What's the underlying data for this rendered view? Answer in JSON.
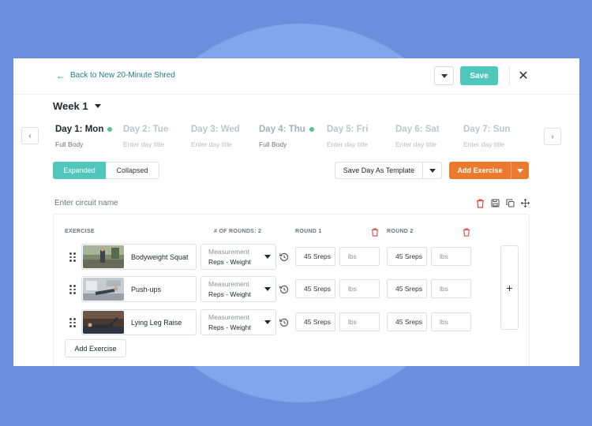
{
  "topbar": {
    "back_label": "Back to New 20-Minute Shred",
    "save_label": "Save"
  },
  "week": {
    "label": "Week 1"
  },
  "days": [
    {
      "label": "Day 1: Mon",
      "title": "Full Body",
      "state": "active",
      "done": true
    },
    {
      "label": "Day 2: Tue",
      "title": "Enter day title",
      "state": "empty",
      "done": false
    },
    {
      "label": "Day 3: Wed",
      "title": "Enter day title",
      "state": "empty",
      "done": false
    },
    {
      "label": "Day 4: Thu",
      "title": "Full Body",
      "state": "complete",
      "done": true
    },
    {
      "label": "Day 5: Fri",
      "title": "Enter day title",
      "state": "empty",
      "done": false
    },
    {
      "label": "Day 6: Sat",
      "title": "Enter day title",
      "state": "empty",
      "done": false
    },
    {
      "label": "Day 7: Sun",
      "title": "Enter day title",
      "state": "empty",
      "done": false
    }
  ],
  "view_toggle": {
    "expanded": "Expanded",
    "collapsed": "Collapsed",
    "selected": "Expanded"
  },
  "save_template_label": "Save Day As Template",
  "add_exercise_label": "Add Exercise",
  "circuit": {
    "name_placeholder": "Enter circuit name",
    "headers": {
      "exercise": "EXERCISE",
      "rounds": "# OF ROUNDS: 2",
      "round1": "ROUND 1",
      "round2": "ROUND 2"
    },
    "rows": [
      {
        "name": "Bodyweight Squat",
        "measurement_label": "Measurement",
        "measurement": "Reps - Weight",
        "r1_reps": "45 Sreps",
        "r1_weight": "lbs",
        "r2_reps": "45 Sreps",
        "r2_weight": "lbs"
      },
      {
        "name": "Push-ups",
        "measurement_label": "Measurement",
        "measurement": "Reps - Weight",
        "r1_reps": "45 Sreps",
        "r1_weight": "lbs",
        "r2_reps": "45 Sreps",
        "r2_weight": "lbs"
      },
      {
        "name": "Lying Leg Raise",
        "measurement_label": "Measurement",
        "measurement": "Reps - Weight",
        "r1_reps": "45 Sreps",
        "r1_weight": "lbs",
        "r2_reps": "45 Sreps",
        "r2_weight": "lbs"
      }
    ],
    "add_exercise_label": "Add Exercise",
    "add_round_symbol": "+"
  },
  "colors": {
    "accent_teal": "#4fc7bb",
    "accent_orange": "#ec7a2d",
    "delete_red": "#e0463c",
    "done_green": "#56c28b",
    "link_teal": "#1f7f84"
  },
  "icons": {
    "back": "arrow-left-icon",
    "close": "close-icon",
    "delete": "trash-icon",
    "save": "save-icon",
    "copy": "copy-icon",
    "move": "move-icon",
    "history": "history-icon",
    "drag": "drag-handle-icon"
  }
}
